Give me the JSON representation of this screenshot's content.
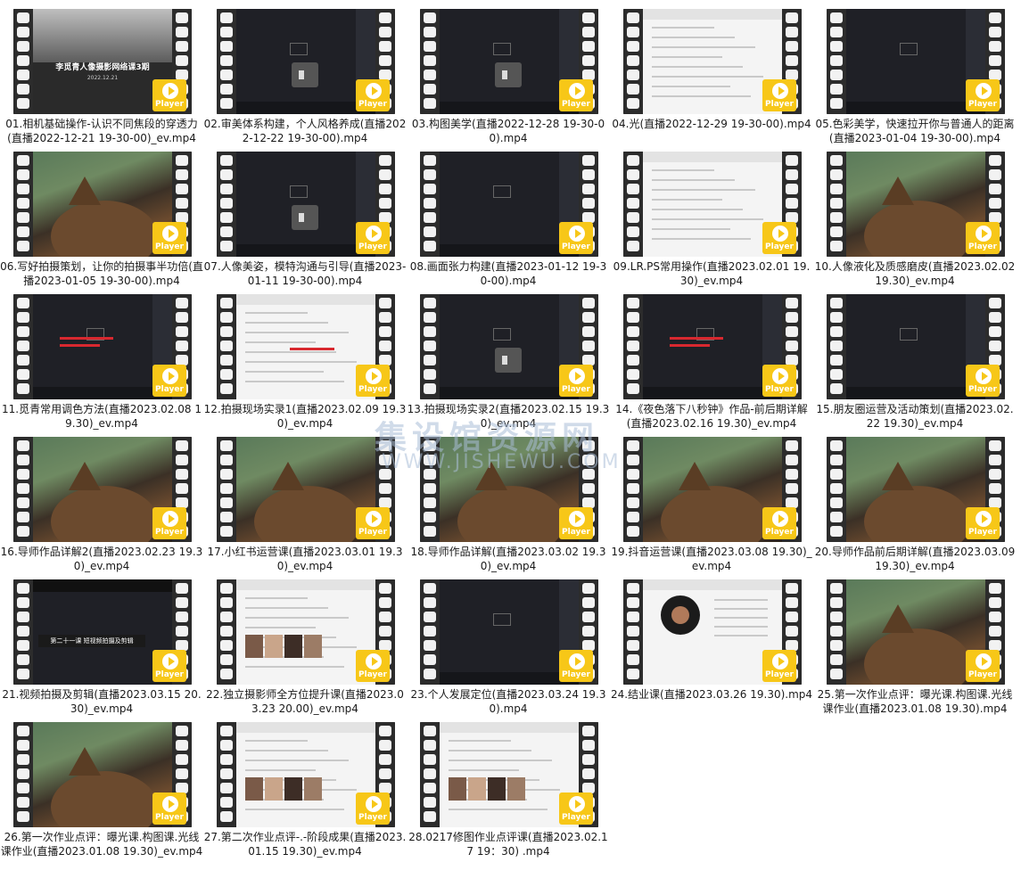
{
  "badge_label": "Player",
  "title_card": {
    "title": "李觅青人像摄影网络课3期",
    "date": "2022.12.21"
  },
  "banner_text": "第二十一课 短视频拍摄及剪辑",
  "overlay_watermark": {
    "line1": "集设馆资源网",
    "line2": "WWW.JISHEWU.COM"
  },
  "colors": {
    "badge": "#f7c718",
    "film": "#2c2c2c",
    "accent_red": "#d8282f"
  },
  "items": [
    {
      "caption": "01.相机基础操作-认识不同焦段的穿透力(直播2022-12-21 19-30-00)_ev.mp4",
      "theme": "title"
    },
    {
      "caption": "02.审美体系构建，个人风格养成(直播2022-12-22 19-30-00).mp4",
      "theme": "dark-vol"
    },
    {
      "caption": "03.构图美学(直播2022-12-28 19-30-00).mp4",
      "theme": "dark-vol"
    },
    {
      "caption": "04.光(直播2022-12-29 19-30-00).mp4",
      "theme": "white"
    },
    {
      "caption": "05.色彩美学，快速拉开你与普通人的距离(直播2023-01-04 19-30-00).mp4",
      "theme": "dark"
    },
    {
      "caption": "06.写好拍摄策划，让你的拍摄事半功倍(直播2023-01-05 19-30-00).mp4",
      "theme": "cat"
    },
    {
      "caption": "07.人像美姿，模特沟通与引导(直播2023-01-11 19-30-00).mp4",
      "theme": "dark-vol"
    },
    {
      "caption": "08.画面张力构建(直播2023-01-12 19-30-00).mp4",
      "theme": "dark"
    },
    {
      "caption": "09.LR.PS常用操作(直播2023.02.01 19.30)_ev.mp4",
      "theme": "white"
    },
    {
      "caption": "10.人像液化及质感磨皮(直播2023.02.02 19.30)_ev.mp4",
      "theme": "cat"
    },
    {
      "caption": "11.觅青常用调色方法(直播2023.02.08 19.30)_ev.mp4",
      "theme": "dark-red"
    },
    {
      "caption": "12.拍摄现场实录1(直播2023.02.09 19.30)_ev.mp4",
      "theme": "white-red"
    },
    {
      "caption": "13.拍摄现场实录2(直播2023.02.15 19.30)_ev.mp4",
      "theme": "dark-vol"
    },
    {
      "caption": "14.《夜色落下八秒钟》作品-前后期详解(直播2023.02.16 19.30)_ev.mp4",
      "theme": "dark-red"
    },
    {
      "caption": "15.朋友圈运营及活动策划(直播2023.02.22 19.30)_ev.mp4",
      "theme": "dark"
    },
    {
      "caption": "16.导师作品详解2(直播2023.02.23 19.30)_ev.mp4",
      "theme": "cat"
    },
    {
      "caption": "17.小红书运营课(直播2023.03.01 19.30)_ev.mp4",
      "theme": "cat"
    },
    {
      "caption": "18.导师作品详解(直播2023.03.02 19.30)_ev.mp4",
      "theme": "cat"
    },
    {
      "caption": "19.抖音运营课(直播2023.03.08 19.30)_ev.mp4",
      "theme": "cat"
    },
    {
      "caption": "20.导师作品前后期详解(直播2023.03.09 19.30)_ev.mp4",
      "theme": "cat"
    },
    {
      "caption": "21.视频拍摄及剪辑(直播2023.03.15 20.30)_ev.mp4",
      "theme": "banner"
    },
    {
      "caption": "22.独立摄影师全方位提升课(直播2023.03.23 20.00)_ev.mp4",
      "theme": "white-photos"
    },
    {
      "caption": "23.个人发展定位(直播2023.03.24 19.30).mp4",
      "theme": "dark"
    },
    {
      "caption": "24.结业课(直播2023.03.26 19.30).mp4",
      "theme": "record"
    },
    {
      "caption": "25.第一次作业点评：曝光课.构图课.光线课作业(直播2023.01.08 19.30).mp4",
      "theme": "cat"
    },
    {
      "caption": "26.第一次作业点评：曝光课.构图课.光线课作业(直播2023.01.08 19.30)_ev.mp4",
      "theme": "cat"
    },
    {
      "caption": "27.第二次作业点评-.-阶段成果(直播2023.01.15 19.30)_ev.mp4",
      "theme": "white-photos"
    },
    {
      "caption": "28.0217修图作业点评课(直播2023.02.17 19：30) .mp4",
      "theme": "white-photos"
    }
  ]
}
